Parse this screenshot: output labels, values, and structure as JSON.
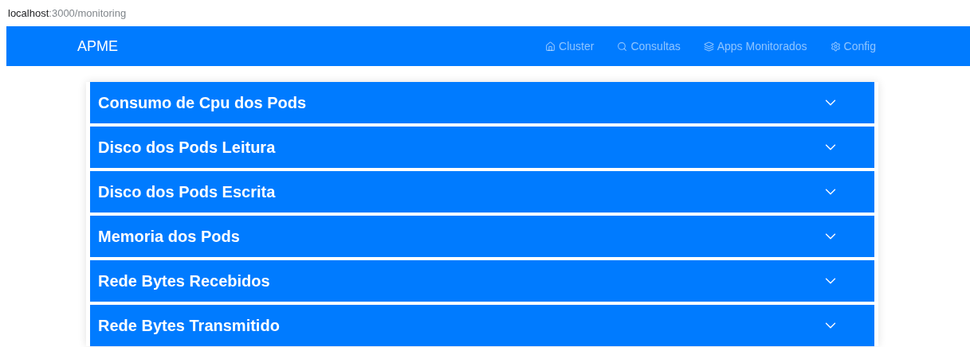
{
  "address_bar": {
    "host": "localhost",
    "path": ":3000/monitoring"
  },
  "navbar": {
    "brand": "APME",
    "links": [
      {
        "label": "Cluster"
      },
      {
        "label": "Consultas"
      },
      {
        "label": "Apps Monitorados"
      },
      {
        "label": "Config"
      }
    ]
  },
  "accordion": [
    {
      "title": "Consumo de Cpu dos Pods",
      "expanded": false
    },
    {
      "title": "Disco dos Pods Leitura",
      "expanded": false
    },
    {
      "title": "Disco dos Pods Escrita",
      "expanded": false
    },
    {
      "title": "Memoria dos Pods",
      "expanded": false
    },
    {
      "title": "Rede Bytes Recebidos",
      "expanded": false
    },
    {
      "title": "Rede Bytes Transmitido",
      "expanded": false
    }
  ]
}
